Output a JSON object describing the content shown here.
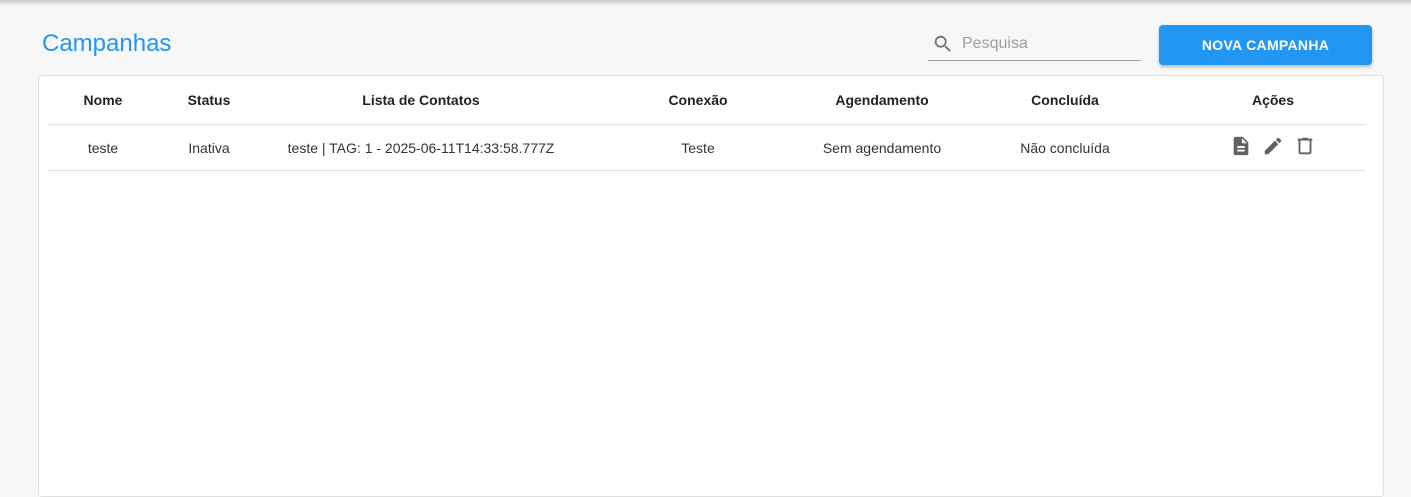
{
  "page": {
    "title": "Campanhas"
  },
  "search": {
    "placeholder": "Pesquisa",
    "value": ""
  },
  "toolbar": {
    "new_campaign_label": "NOVA CAMPANHA"
  },
  "table": {
    "columns": [
      "Nome",
      "Status",
      "Lista de Contatos",
      "Conexão",
      "Agendamento",
      "Concluída",
      "Ações"
    ],
    "rows": [
      {
        "nome": "teste",
        "status": "Inativa",
        "lista": "teste | TAG: 1 - 2025-06-11T14:33:58.777Z",
        "conexao": "Teste",
        "agendamento": "Sem agendamento",
        "concluida": "Não concluída",
        "actions": [
          "report-icon",
          "edit-icon",
          "delete-icon"
        ]
      }
    ]
  },
  "colors": {
    "accent": "#2196f3",
    "icon": "#616161"
  }
}
